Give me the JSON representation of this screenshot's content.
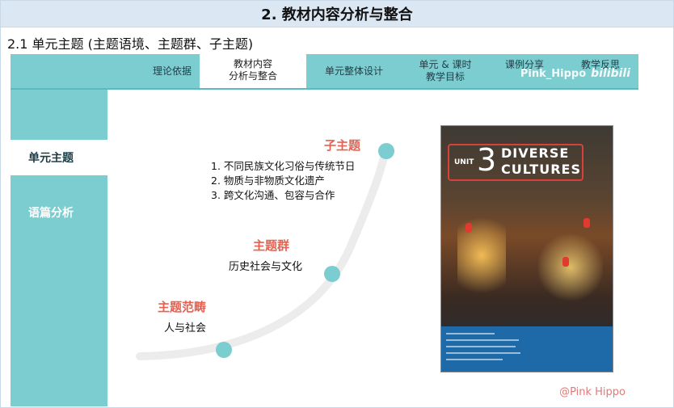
{
  "header": {
    "title": "2. 教材内容分析与整合"
  },
  "section": {
    "heading": "2.1  单元主题 (主题语境、主题群、子主题)"
  },
  "tabs": [
    {
      "label": "理论依据"
    },
    {
      "label_line1": "教材内容",
      "label_line2": "分析与整合"
    },
    {
      "label": "单元整体设计"
    },
    {
      "label_line1": "单元 & 课时",
      "label_line2": "教学目标"
    },
    {
      "label": "课例分享"
    },
    {
      "label": "教学反思"
    }
  ],
  "watermark": {
    "top": "Pink_Hippo",
    "top_brand": "bilibili",
    "bottom": "@Pink Hippo"
  },
  "sidebar": {
    "items": [
      {
        "label": "单元主题"
      },
      {
        "label": "语篇分析"
      }
    ]
  },
  "diagram": {
    "node3": {
      "title": "子主题",
      "items": [
        "1. 不同民族文化习俗与传统节日",
        "2. 物质与非物质文化遗产",
        "3. 跨文化沟通、包容与合作"
      ]
    },
    "node2": {
      "title": "主题群",
      "text": "历史社会与文化"
    },
    "node1": {
      "title": "主题范畴",
      "text": "人与社会"
    },
    "colors": {
      "accent": "#e8604f",
      "dot": "#7ccdd0",
      "curve": "#ececec"
    }
  },
  "book": {
    "unit_word": "UNIT",
    "unit_number": "3",
    "title_line1": "DIVERSE",
    "title_line2": "CULTURES"
  }
}
